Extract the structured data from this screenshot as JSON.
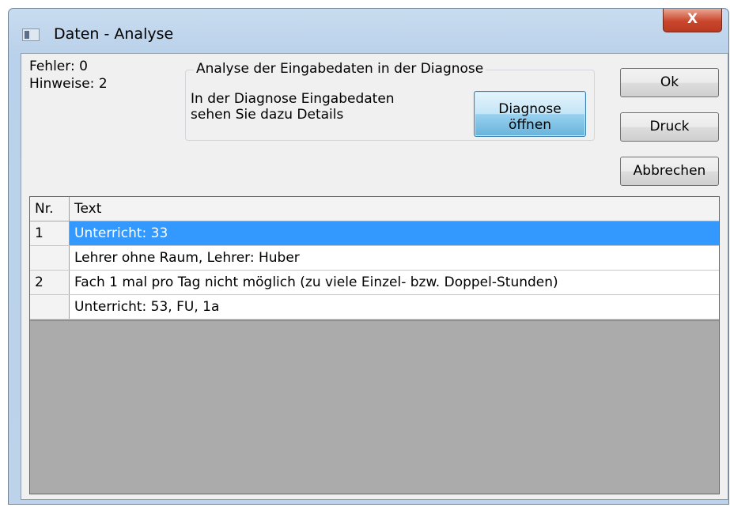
{
  "window": {
    "title": "Daten - Analyse",
    "close_label": "X"
  },
  "stats": {
    "errors": "Fehler: 0",
    "hints": "Hinweise: 2"
  },
  "group": {
    "title": "Analyse der Eingabedaten in der Diagnose",
    "text_line1": "In der Diagnose Eingabedaten",
    "text_line2": "sehen Sie dazu Details",
    "diag_button_line1": "Diagnose",
    "diag_button_line2": "öffnen"
  },
  "buttons": {
    "ok": "Ok",
    "print": "Druck",
    "cancel": "Abbrechen"
  },
  "table": {
    "columns": [
      "Nr.",
      "Text"
    ],
    "rows": [
      {
        "nr": "1",
        "text": "Unterricht: 33",
        "selected": true
      },
      {
        "nr": "",
        "text": "Lehrer ohne Raum, Lehrer: Huber",
        "selected": false
      },
      {
        "nr": "2",
        "text": "Fach 1 mal pro Tag nicht möglich (zu viele Einzel- bzw. Doppel-Stunden)",
        "selected": false
      },
      {
        "nr": "",
        "text": "Unterricht: 53, FU, 1a",
        "selected": false
      }
    ]
  },
  "colors": {
    "selection": "#3399ff",
    "close_button": "#c9462c",
    "title_bar": "#b9d1ea"
  }
}
